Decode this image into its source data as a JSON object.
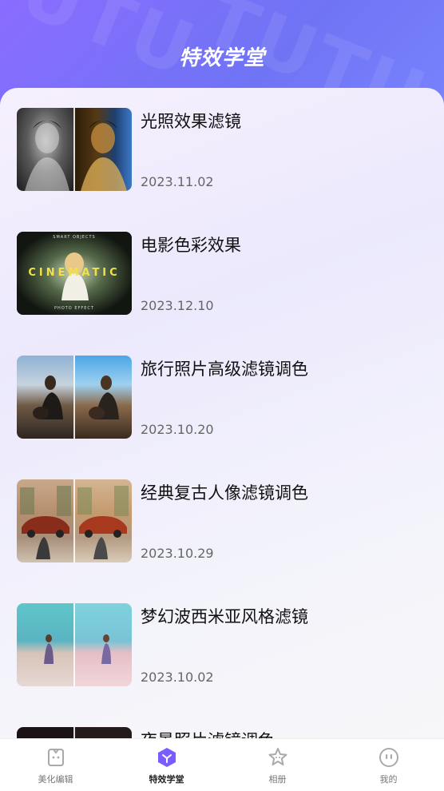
{
  "header": {
    "title": "特效学堂",
    "watermark": "TUTU"
  },
  "items": [
    {
      "title": "光照效果滤镜",
      "date": "2023.11.02",
      "thumb": "portrait-lighting-before-after"
    },
    {
      "title": "电影色彩效果",
      "date": "2023.12.10",
      "thumb": "cinematic-poster",
      "thumb_text": {
        "top": "SMART OBJECTS",
        "main": "CINEMATIC",
        "bottom": "PHOTO EFFECT"
      }
    },
    {
      "title": "旅行照片高级滤镜调色",
      "date": "2023.10.20",
      "thumb": "travel-before-after"
    },
    {
      "title": "经典复古人像滤镜调色",
      "date": "2023.10.29",
      "thumb": "vintage-street-before-after"
    },
    {
      "title": "梦幻波西米亚风格滤镜",
      "date": "2023.10.02",
      "thumb": "beach-before-after"
    },
    {
      "title": "夜景照片滤镜调色",
      "date": "",
      "thumb": "night-partial"
    }
  ],
  "tabs": [
    {
      "label": "美化编辑",
      "icon": "edit-face-icon",
      "active": false
    },
    {
      "label": "特效学堂",
      "icon": "effects-academy-icon",
      "active": true
    },
    {
      "label": "相册",
      "icon": "album-star-icon",
      "active": false
    },
    {
      "label": "我的",
      "icon": "profile-face-icon",
      "active": false
    }
  ],
  "colors": {
    "accent": "#7a5cff",
    "header_start": "#8a6cff",
    "header_end": "#7a86ff"
  }
}
